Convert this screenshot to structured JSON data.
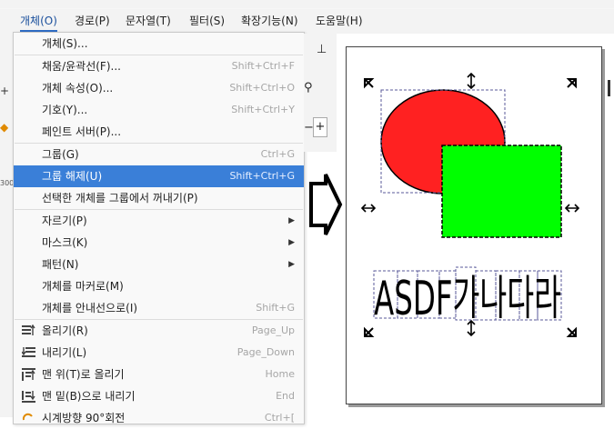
{
  "menubar": {
    "items": [
      {
        "label": "개체(O)",
        "active": true
      },
      {
        "label": "경로(P)"
      },
      {
        "label": "문자열(T)"
      },
      {
        "label": "필터(S)"
      },
      {
        "label": "확장기능(N)"
      },
      {
        "label": "도움말(H)"
      }
    ]
  },
  "dropdown": {
    "items": [
      {
        "label": "개체(S)...",
        "shortcut": ""
      },
      {
        "label": "채움/윤곽선(F)...",
        "shortcut": "Shift+Ctrl+F"
      },
      {
        "label": "개체 속성(O)...",
        "shortcut": "Shift+Ctrl+O"
      },
      {
        "label": "기호(Y)...",
        "shortcut": "Shift+Ctrl+Y"
      },
      {
        "label": "페인트 서버(P)...",
        "shortcut": ""
      },
      {
        "label": "그룹(G)",
        "shortcut": "Ctrl+G"
      },
      {
        "label": "그룹 해제(U)",
        "shortcut": "Shift+Ctrl+G"
      },
      {
        "label": "선택한 개체를 그룹에서 꺼내기(P)",
        "shortcut": ""
      },
      {
        "label": "자르기(P)",
        "shortcut": ""
      },
      {
        "label": "마스크(K)",
        "shortcut": ""
      },
      {
        "label": "패턴(N)",
        "shortcut": ""
      },
      {
        "label": "개체를 마커로(M)",
        "shortcut": ""
      },
      {
        "label": "개체를 안내선으로(I)",
        "shortcut": "Shift+G"
      },
      {
        "label": "올리기(R)",
        "shortcut": "Page_Up"
      },
      {
        "label": "내리기(L)",
        "shortcut": "Page_Down"
      },
      {
        "label": "맨 위(T)로 올리기",
        "shortcut": "Home"
      },
      {
        "label": "맨 밑(B)으로 내리기",
        "shortcut": "End"
      },
      {
        "label": "시계방향 90°회전",
        "shortcut": "Ctrl+["
      }
    ]
  },
  "left_ruler": {
    "label": "300"
  },
  "canvas": {
    "text": "ASDF가나다라",
    "colors": {
      "ellipse": "#ff2121",
      "rect": "#00ff00",
      "selection": "#5a5a9a"
    }
  },
  "colors": {
    "menu_highlight": "#3a7fd8",
    "accent": "#2f6dc6"
  }
}
